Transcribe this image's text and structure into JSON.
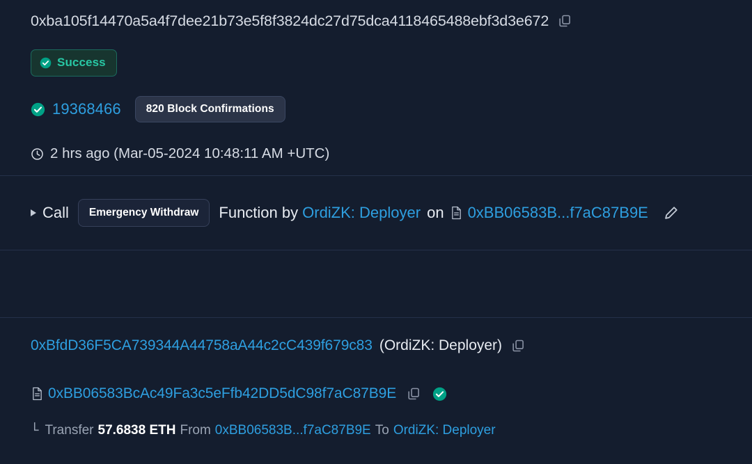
{
  "transaction": {
    "hash": "0xba105f14470a5a4f7dee21b73e5f8f3824dc27d75dca4118465488ebf3d3e672",
    "copy_hash_icon": "copy-icon",
    "status": {
      "label": "Success",
      "icon": "check-circle-icon",
      "color": "#28c7a4"
    },
    "block": {
      "icon": "check-circle-icon",
      "number": "19368466",
      "confirmations": "820 Block Confirmations"
    },
    "timestamp": {
      "icon": "clock-icon",
      "text": "2 hrs ago (Mar-05-2024 10:48:11 AM +UTC)"
    }
  },
  "action": {
    "toggle_icon": "caret-right-icon",
    "call_word": "Call",
    "function_name": "Emergency Withdraw",
    "function_by": "Function by",
    "caller": "OrdiZK: Deployer",
    "on_word": "on",
    "contract_icon": "document-icon",
    "contract_short": "0xBB06583B...f7aC87B9E",
    "edit_icon": "pencil-icon"
  },
  "parties": {
    "from": {
      "address": "0xBfdD36F5CA739344A44758aA44c2cC439f679c83",
      "alias": "(OrdiZK: Deployer)",
      "copy_icon": "copy-icon"
    },
    "interacted_with": {
      "icon": "document-icon",
      "address": "0xBB06583BcAc49Fa3c5eFfb42DD5dC98f7aC87B9E",
      "copy_icon": "copy-icon",
      "verified_icon": "check-circle-icon"
    }
  },
  "transfer": {
    "tree_glyph": "└",
    "label": "Transfer",
    "amount": "57.6838 ETH",
    "from_word": "From",
    "from_address": "0xBB06583B...f7aC87B9E",
    "to_word": "To",
    "to_address": "OrdiZK: Deployer"
  },
  "colors": {
    "background": "#141d2e",
    "link": "#2e9fe0",
    "success": "#28c7a4",
    "divider": "#24304a",
    "text": "#d6dbe4",
    "muted": "#9aa4b4"
  }
}
